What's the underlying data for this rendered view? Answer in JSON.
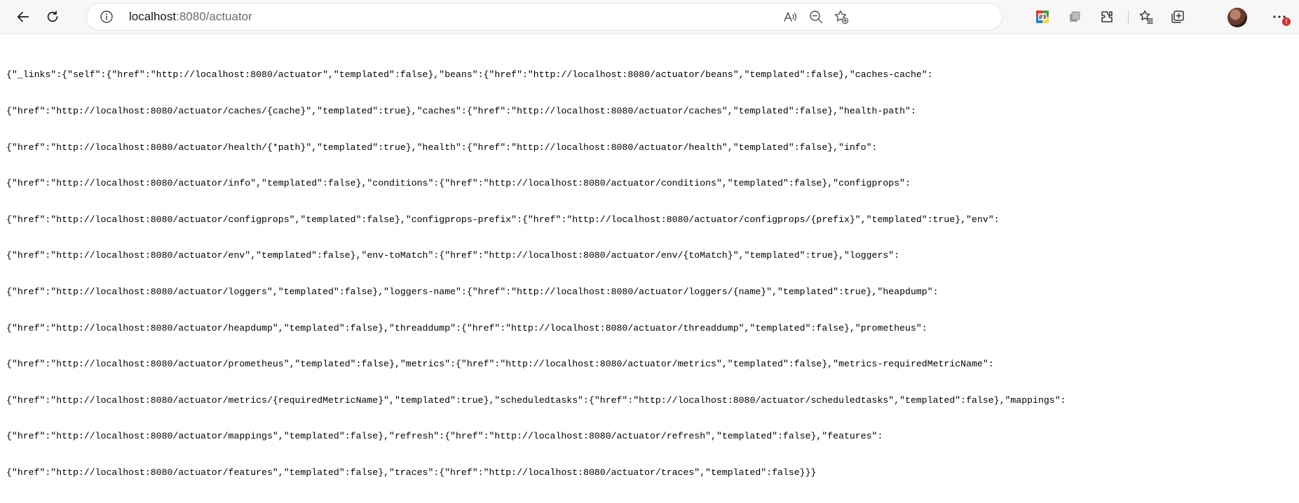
{
  "browser": {
    "url_host": "localhost",
    "url_rest": ":8080/actuator",
    "icons": [
      "back-icon",
      "refresh-icon",
      "info-icon",
      "read-aloud-icon",
      "zoom-out-icon",
      "add-favorite-icon",
      "extension-s3-icon",
      "collections-icon",
      "extensions-icon",
      "favorites-icon",
      "tab-actions-icon",
      "profile-avatar",
      "more-icon"
    ]
  },
  "page": {
    "lines": [
      "{\"_links\":{\"self\":{\"href\":\"http://localhost:8080/actuator\",\"templated\":false},\"beans\":{\"href\":\"http://localhost:8080/actuator/beans\",\"templated\":false},\"caches-cache\":",
      "{\"href\":\"http://localhost:8080/actuator/caches/{cache}\",\"templated\":true},\"caches\":{\"href\":\"http://localhost:8080/actuator/caches\",\"templated\":false},\"health-path\":",
      "{\"href\":\"http://localhost:8080/actuator/health/{*path}\",\"templated\":true},\"health\":{\"href\":\"http://localhost:8080/actuator/health\",\"templated\":false},\"info\":",
      "{\"href\":\"http://localhost:8080/actuator/info\",\"templated\":false},\"conditions\":{\"href\":\"http://localhost:8080/actuator/conditions\",\"templated\":false},\"configprops\":",
      "{\"href\":\"http://localhost:8080/actuator/configprops\",\"templated\":false},\"configprops-prefix\":{\"href\":\"http://localhost:8080/actuator/configprops/{prefix}\",\"templated\":true},\"env\":",
      "{\"href\":\"http://localhost:8080/actuator/env\",\"templated\":false},\"env-toMatch\":{\"href\":\"http://localhost:8080/actuator/env/{toMatch}\",\"templated\":true},\"loggers\":",
      "{\"href\":\"http://localhost:8080/actuator/loggers\",\"templated\":false},\"loggers-name\":{\"href\":\"http://localhost:8080/actuator/loggers/{name}\",\"templated\":true},\"heapdump\":",
      "{\"href\":\"http://localhost:8080/actuator/heapdump\",\"templated\":false},\"threaddump\":{\"href\":\"http://localhost:8080/actuator/threaddump\",\"templated\":false},\"prometheus\":",
      "{\"href\":\"http://localhost:8080/actuator/prometheus\",\"templated\":false},\"metrics\":{\"href\":\"http://localhost:8080/actuator/metrics\",\"templated\":false},\"metrics-requiredMetricName\":",
      "{\"href\":\"http://localhost:8080/actuator/metrics/{requiredMetricName}\",\"templated\":true},\"scheduledtasks\":{\"href\":\"http://localhost:8080/actuator/scheduledtasks\",\"templated\":false},\"mappings\":",
      "{\"href\":\"http://localhost:8080/actuator/mappings\",\"templated\":false},\"refresh\":{\"href\":\"http://localhost:8080/actuator/refresh\",\"templated\":false},\"features\":",
      "{\"href\":\"http://localhost:8080/actuator/features\",\"templated\":false},\"traces\":{\"href\":\"http://localhost:8080/actuator/traces\",\"templated\":false}}}"
    ]
  }
}
